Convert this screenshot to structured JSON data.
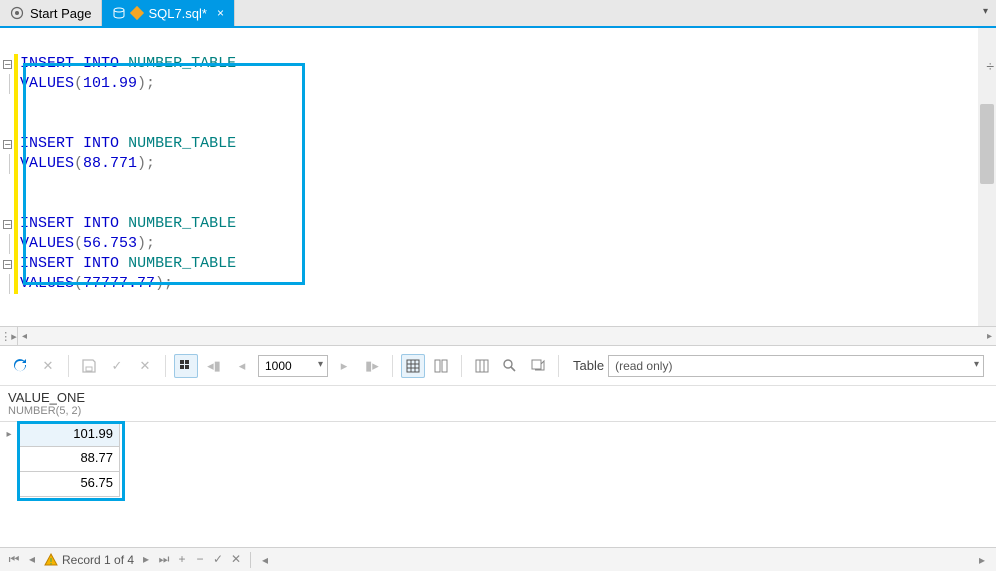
{
  "tabs": {
    "start": "Start Page",
    "active": "SQL7.sql*"
  },
  "editor": {
    "statements": [
      {
        "keyword1": "INSERT",
        "keyword2": "INTO",
        "table": "NUMBER_TABLE",
        "values_kw": "VALUES",
        "value": "101.99"
      },
      {
        "keyword1": "INSERT",
        "keyword2": "INTO",
        "table": "NUMBER_TABLE",
        "values_kw": "VALUES",
        "value": "88.771"
      },
      {
        "keyword1": "INSERT",
        "keyword2": "INTO",
        "table": "NUMBER_TABLE",
        "values_kw": "VALUES",
        "value": "56.753"
      },
      {
        "keyword1": "INSERT",
        "keyword2": "INTO",
        "table": "NUMBER_TABLE",
        "values_kw": "VALUES",
        "value": "77777.77"
      }
    ]
  },
  "toolbar": {
    "limit": "1000",
    "object_label": "Table",
    "readonly_text": "(read only)"
  },
  "grid": {
    "column_name": "VALUE_ONE",
    "column_type": "NUMBER(5, 2)",
    "rows": [
      "101.99",
      "88.77",
      "56.75"
    ]
  },
  "status": {
    "record_text": "Record 1 of 4"
  }
}
